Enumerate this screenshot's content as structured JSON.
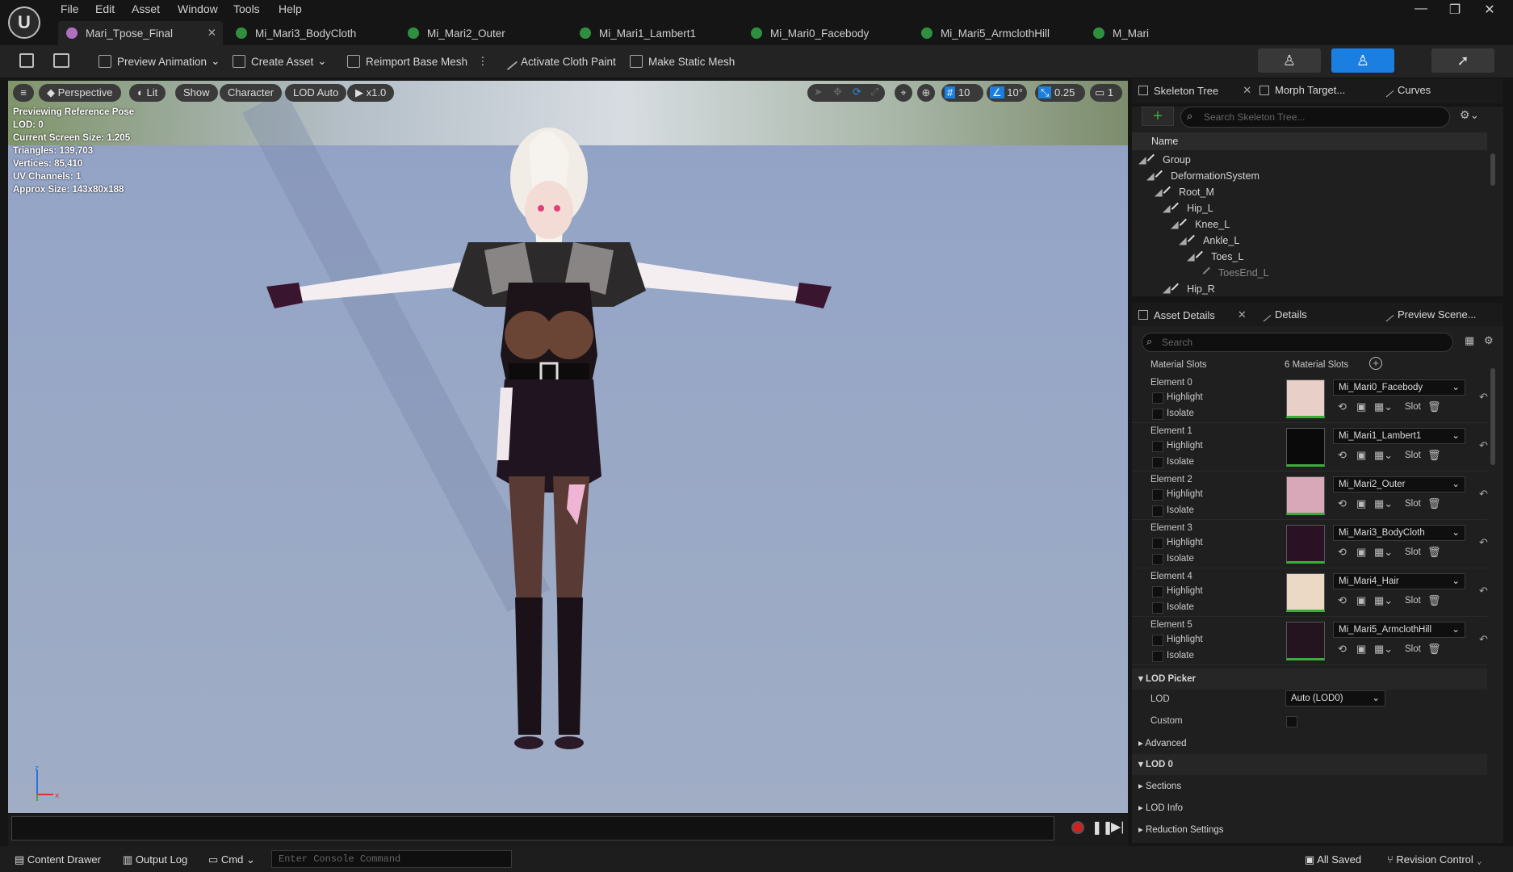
{
  "menu": [
    "File",
    "Edit",
    "Asset",
    "Window",
    "Tools",
    "Help"
  ],
  "tabs": [
    {
      "label": "Mari_Tpose_Final",
      "icon": "skeletal-mesh-icon"
    },
    {
      "label": "Mi_Mari3_BodyCloth",
      "icon": "material-instance-icon"
    },
    {
      "label": "Mi_Mari2_Outer",
      "icon": "material-instance-icon"
    },
    {
      "label": "Mi_Mari1_Lambert1",
      "icon": "material-instance-icon"
    },
    {
      "label": "Mi_Mari0_Facebody",
      "icon": "material-instance-icon"
    },
    {
      "label": "Mi_Mari5_ArmclothHill",
      "icon": "material-instance-icon"
    },
    {
      "label": "M_Mari",
      "icon": "material-icon"
    }
  ],
  "toolbar": {
    "preview_animation": "Preview Animation",
    "create_asset": "Create Asset",
    "reimport": "Reimport Base Mesh",
    "cloth_paint": "Activate Cloth Paint",
    "static_mesh": "Make Static Mesh"
  },
  "viewport": {
    "view_mode": "Perspective",
    "lit": "Lit",
    "show": "Show",
    "character": "Character",
    "lod": "LOD Auto",
    "play_rate": "x1.0",
    "grid_snap": "10",
    "angle_snap": "10°",
    "scale_snap": "0.25",
    "camera_speed": "1",
    "stats": [
      "Previewing Reference Pose",
      "LOD: 0",
      "Current Screen Size: 1.205",
      "Triangles: 139,703",
      "Vertices: 85,410",
      "UV Channels: 1",
      "Approx Size: 143x80x188"
    ]
  },
  "skeleton_tree": {
    "tabs": [
      "Skeleton Tree",
      "Morph Target...",
      "Curves"
    ],
    "search_placeholder": "Search Skeleton Tree...",
    "column": "Name",
    "bones": [
      {
        "name": "Group",
        "depth": 0
      },
      {
        "name": "DeformationSystem",
        "depth": 1
      },
      {
        "name": "Root_M",
        "depth": 2
      },
      {
        "name": "Hip_L",
        "depth": 3
      },
      {
        "name": "Knee_L",
        "depth": 4
      },
      {
        "name": "Ankle_L",
        "depth": 5
      },
      {
        "name": "Toes_L",
        "depth": 6
      },
      {
        "name": "ToesEnd_L",
        "depth": 7
      },
      {
        "name": "Hip_R",
        "depth": 3
      }
    ]
  },
  "asset_details": {
    "tabs": [
      "Asset Details",
      "Details",
      "Preview Scene..."
    ],
    "search_placeholder": "Search",
    "material_slots_label": "Material Slots",
    "material_slots_count": "6 Material Slots",
    "highlight_label": "Highlight",
    "isolate_label": "Isolate",
    "slot_label": "Slot",
    "elements": [
      {
        "label": "Element 0",
        "material": "Mi_Mari0_Facebody",
        "thumb": "#e8cfc8"
      },
      {
        "label": "Element 1",
        "material": "Mi_Mari1_Lambert1",
        "thumb": "#0a0a0a"
      },
      {
        "label": "Element 2",
        "material": "Mi_Mari2_Outer",
        "thumb": "#d8a8b8"
      },
      {
        "label": "Element 3",
        "material": "Mi_Mari3_BodyCloth",
        "thumb": "#2a1224"
      },
      {
        "label": "Element 4",
        "material": "Mi_Mari4_Hair",
        "thumb": "#ecd9c5"
      },
      {
        "label": "Element 5",
        "material": "Mi_Mari5_ArmclothHill",
        "thumb": "#241420"
      }
    ],
    "lod_picker": "LOD Picker",
    "lod_label": "LOD",
    "lod_value": "Auto (LOD0)",
    "custom_label": "Custom",
    "advanced": "Advanced",
    "lod0": "LOD 0",
    "sections": "Sections",
    "lod_info": "LOD Info",
    "reduction": "Reduction Settings"
  },
  "statusbar": {
    "content_drawer": "Content Drawer",
    "output_log": "Output Log",
    "cmd": "Cmd",
    "console_placeholder": "Enter Console Command",
    "all_saved": "All Saved",
    "revision": "Revision Control"
  }
}
